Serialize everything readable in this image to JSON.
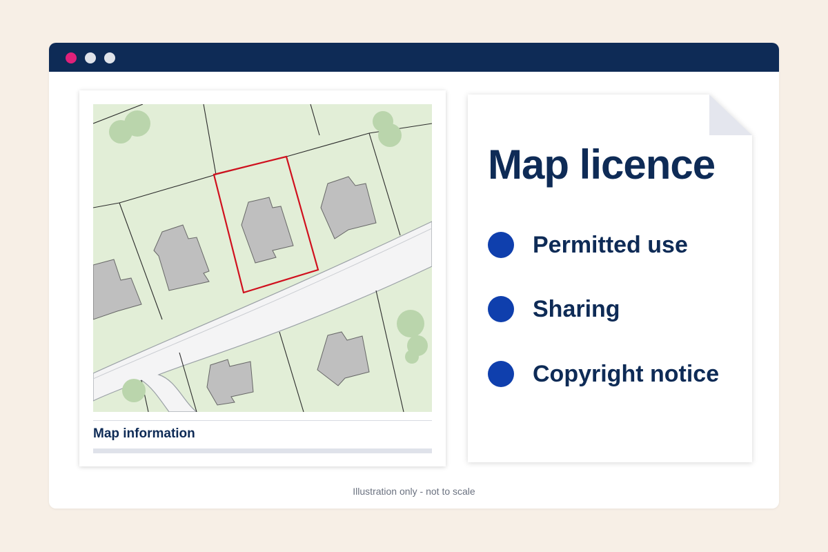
{
  "window": {
    "controls": [
      "close",
      "minimize",
      "maximize"
    ]
  },
  "map_panel": {
    "caption": "Map information"
  },
  "licence_doc": {
    "title": "Map licence",
    "items": [
      {
        "label": "Permitted use"
      },
      {
        "label": "Sharing"
      },
      {
        "label": "Copyright notice"
      }
    ]
  },
  "footer": {
    "caption": "Illustration only - not to scale"
  },
  "colors": {
    "titlebar": "#0e2b56",
    "close_dot": "#e0217a",
    "accent_bullet": "#0f3fad",
    "selected_plot_outline": "#d0101e",
    "map_background": "#e2eed7",
    "building": "#bfbfbf",
    "tree": "#bad5ac"
  }
}
